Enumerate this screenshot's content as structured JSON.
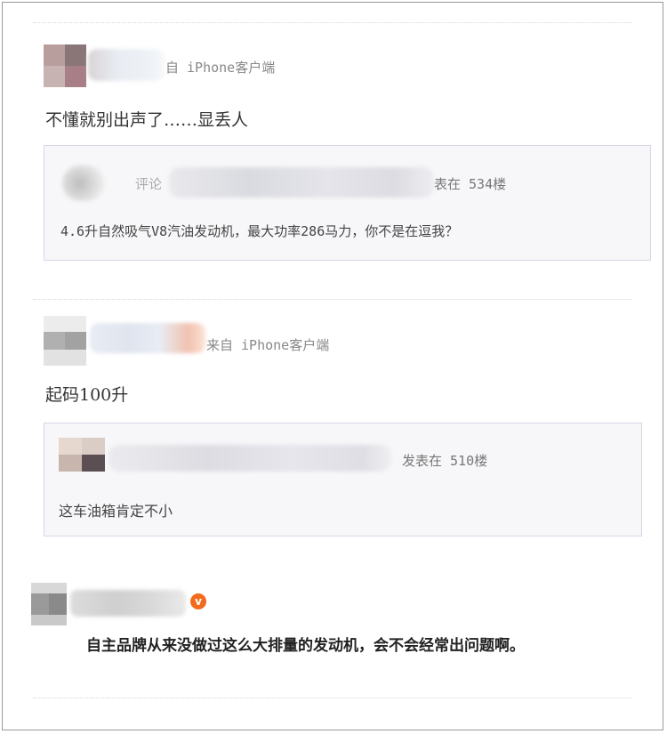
{
  "comments": [
    {
      "source": "自 iPhone客户端",
      "text": "不懂就别出声了……显丢人",
      "quote": {
        "prefix": "评论",
        "floor": "表在 534楼",
        "text": "4.6升自然吸气V8汽油发动机，最大功率286马力，你不是在逗我？"
      }
    },
    {
      "source": "来自 iPhone客户端",
      "text": "起码100升",
      "quote": {
        "floor": "发表在 510楼",
        "text": "这车油箱肯定不小"
      }
    },
    {
      "badge": "v",
      "text": "自主品牌从来没做过这么大排量的发动机，会不会经常出问题啊。"
    }
  ],
  "colors": {
    "badge": "#f26b1d",
    "quote_border": "#d6d6e6",
    "quote_bg": "#f7f7f9"
  }
}
